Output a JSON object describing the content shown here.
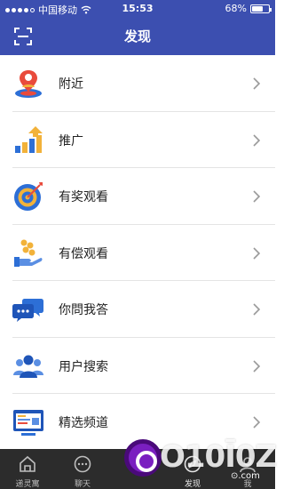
{
  "status_bar": {
    "carrier": "中国移动",
    "time": "15:53",
    "battery_text": "68%",
    "battery_level": 0.68,
    "signal_bars": 4
  },
  "navbar": {
    "title": "发现",
    "scan_icon": "scan-icon"
  },
  "menu": [
    {
      "label": "附近",
      "icon": "location-person-icon"
    },
    {
      "label": "推广",
      "icon": "growth-arrow-icon"
    },
    {
      "label": "有奖观看",
      "icon": "target-icon"
    },
    {
      "label": "有偿观看",
      "icon": "coins-hand-icon"
    },
    {
      "label": "你問我答",
      "icon": "chat-bubbles-icon"
    },
    {
      "label": "用户搜索",
      "icon": "users-icon"
    },
    {
      "label": "精选频道",
      "icon": "channel-screen-icon"
    }
  ],
  "tabbar": {
    "tabs": [
      {
        "label": "递灵寓",
        "icon": "home-icon"
      },
      {
        "label": "聊天",
        "icon": "chat-icon"
      },
      {
        "label": "",
        "icon": "live-icon"
      },
      {
        "label": "发现",
        "icon": "discover-icon",
        "active": true
      },
      {
        "label": "我",
        "icon": "profile-icon"
      }
    ]
  },
  "watermark": {
    "text": "O10Ī0Z",
    "domain": "⊙.com"
  },
  "colors": {
    "primary": "#3c4fb0",
    "tabbar": "#2c2c2c",
    "divider": "#e4e4e4"
  }
}
